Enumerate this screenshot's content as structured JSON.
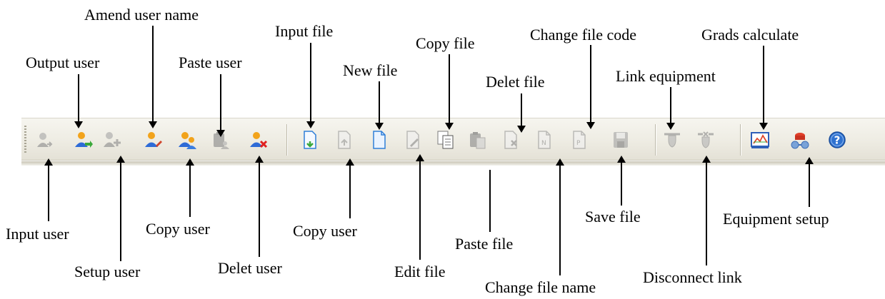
{
  "toolbar": {
    "buttons": [
      {
        "name": "input-user-button",
        "icon": "user-import-icon",
        "enabled": false
      },
      {
        "name": "output-user-button",
        "icon": "user-export-icon",
        "enabled": true
      },
      {
        "name": "setup-user-button",
        "icon": "user-add-icon",
        "enabled": false
      },
      {
        "name": "amend-user-name-button",
        "icon": "user-edit-icon",
        "enabled": true
      },
      {
        "name": "copy-user-button",
        "icon": "user-copy-icon",
        "enabled": true
      },
      {
        "name": "paste-user-button",
        "icon": "user-paste-icon",
        "enabled": false
      },
      {
        "name": "delet-user-button",
        "icon": "user-delete-icon",
        "enabled": true
      },
      {
        "name": "input-file-button",
        "icon": "file-import-icon",
        "enabled": true
      },
      {
        "name": "copy-file-user-button",
        "icon": "file-export-icon",
        "enabled": false
      },
      {
        "name": "new-file-button",
        "icon": "file-new-icon",
        "enabled": true
      },
      {
        "name": "edit-file-button",
        "icon": "file-edit-icon",
        "enabled": false
      },
      {
        "name": "copy-file-button",
        "icon": "file-copy-icon",
        "enabled": true
      },
      {
        "name": "paste-file-button",
        "icon": "file-paste-icon",
        "enabled": false
      },
      {
        "name": "delet-file-button",
        "icon": "file-delete-icon",
        "enabled": false
      },
      {
        "name": "change-file-name-button",
        "icon": "file-rename-icon",
        "enabled": false
      },
      {
        "name": "change-file-code-button",
        "icon": "file-code-icon",
        "enabled": false
      },
      {
        "name": "save-file-button",
        "icon": "save-icon",
        "enabled": false
      },
      {
        "name": "link-equipment-button",
        "icon": "link-equipment-icon",
        "enabled": false
      },
      {
        "name": "disconnect-link-button",
        "icon": "disconnect-link-icon",
        "enabled": false
      },
      {
        "name": "grads-calculate-button",
        "icon": "chart-calculate-icon",
        "enabled": true
      },
      {
        "name": "equipment-setup-button",
        "icon": "equipment-setup-icon",
        "enabled": true
      },
      {
        "name": "help-button",
        "icon": "help-icon",
        "enabled": true
      }
    ]
  },
  "labels": {
    "amend_user_name": "Amend user name",
    "input_file": "Input file",
    "copy_file": "Copy file",
    "change_file_code": "Change file code",
    "grads_calculate": "Grads calculate",
    "output_user": "Output user",
    "paste_user": "Paste user",
    "new_file": "New file",
    "delet_file": "Delet file",
    "link_equipment": "Link equipment",
    "input_user": "Input user",
    "copy_user_left": "Copy user",
    "copy_user_right": "Copy user",
    "setup_user": "Setup user",
    "delet_user": "Delet user",
    "edit_file": "Edit file",
    "paste_file": "Paste file",
    "change_file_name": "Change file name",
    "save_file": "Save file",
    "disconnect_link": "Disconnect link",
    "equipment_setup": "Equipment setup"
  },
  "colors": {
    "toolbar_bg": "#eeece3",
    "user_head": "#f2a31b",
    "user_body": "#2e6bd6",
    "file_blue": "#2f7fd8",
    "accept_green": "#3aa83a",
    "delete_red": "#e02020",
    "disabled_gray": "#9a9a9a"
  }
}
